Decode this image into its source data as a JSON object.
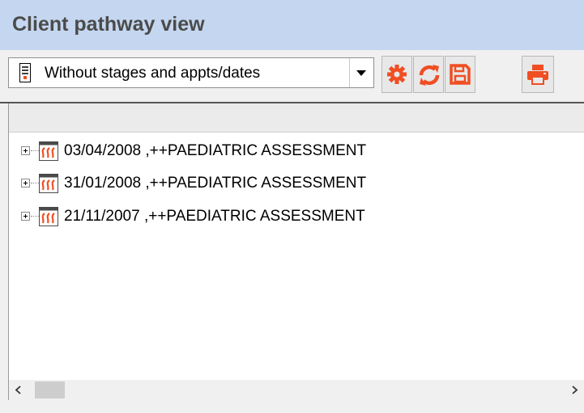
{
  "title": "Client pathway view",
  "toolbar": {
    "view_select": {
      "selected": "Without stages and appts/dates",
      "icon": "document-list-icon"
    },
    "buttons": [
      {
        "name": "settings-button",
        "icon": "gear-icon"
      },
      {
        "name": "refresh-button",
        "icon": "refresh-icon"
      },
      {
        "name": "save-button",
        "icon": "floppy-disk-icon"
      },
      {
        "name": "print-button",
        "icon": "printer-icon"
      }
    ],
    "accent_color": "#f04e23"
  },
  "tree": {
    "items": [
      {
        "label": "03/04/2008 ,++PAEDIATRIC ASSESSMENT",
        "icon": "pathway-icon",
        "expanded": false
      },
      {
        "label": "31/01/2008 ,++PAEDIATRIC ASSESSMENT",
        "icon": "pathway-icon",
        "expanded": false
      },
      {
        "label": "21/11/2007 ,++PAEDIATRIC ASSESSMENT",
        "icon": "pathway-icon",
        "expanded": false
      }
    ]
  },
  "colors": {
    "title_bar": "#c5d7f0",
    "accent": "#f04e23"
  }
}
